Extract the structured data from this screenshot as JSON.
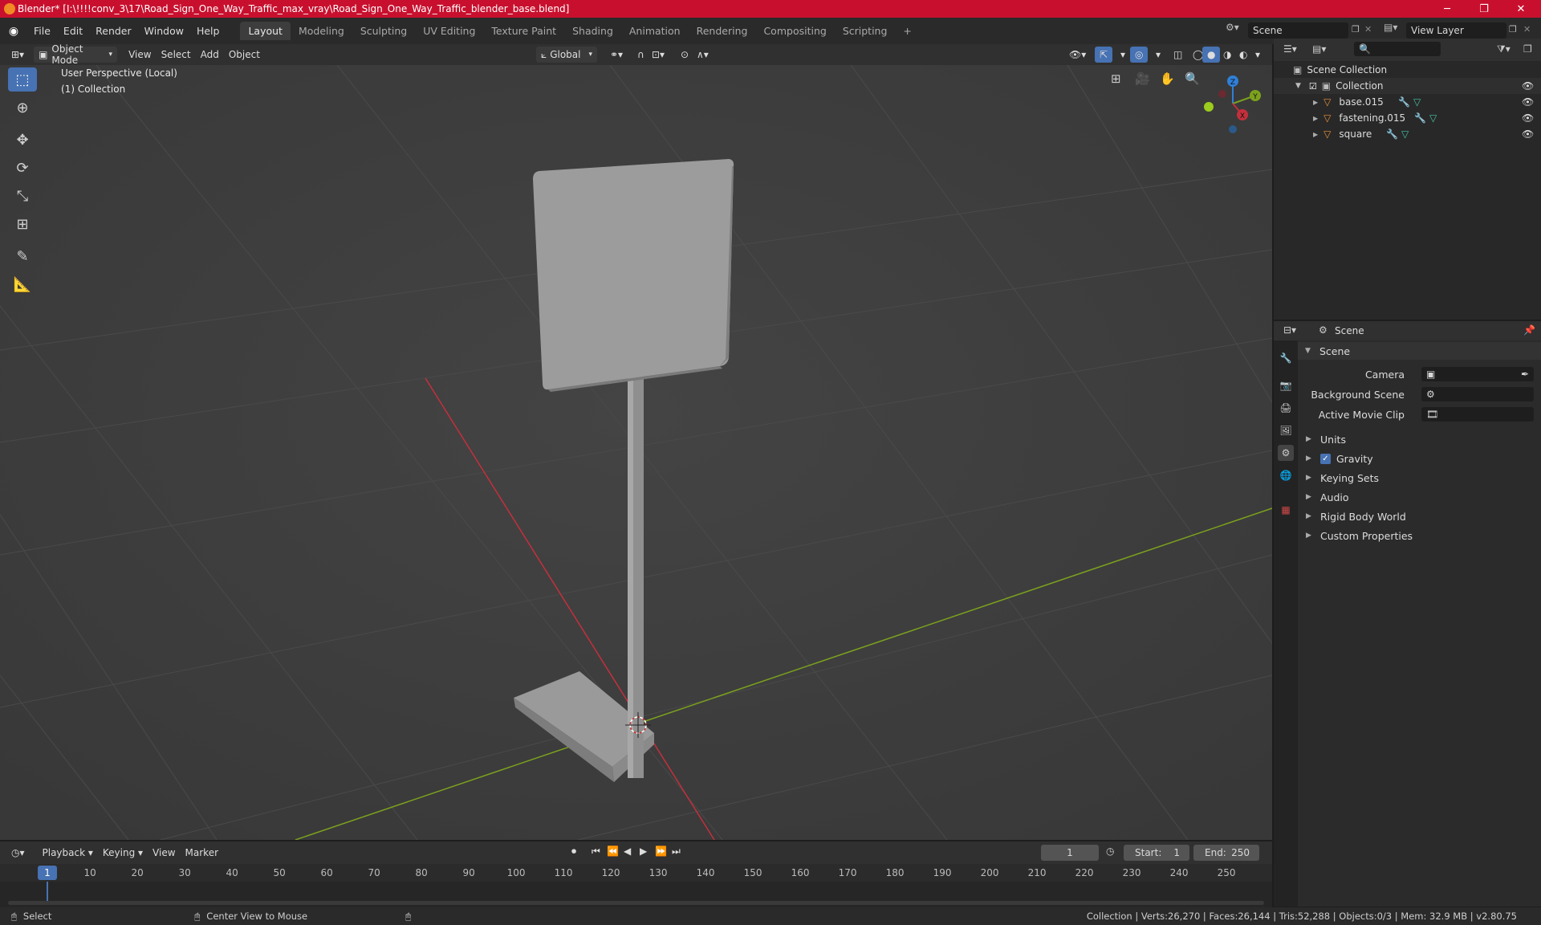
{
  "window": {
    "title": "Blender* [I:\\!!!!conv_3\\17\\Road_Sign_One_Way_Traffic_max_vray\\Road_Sign_One_Way_Traffic_blender_base.blend]",
    "minimize": "─",
    "maximize": "❐",
    "close": "✕"
  },
  "menu": {
    "items": [
      "File",
      "Edit",
      "Render",
      "Window",
      "Help"
    ]
  },
  "workspaces": [
    "Layout",
    "Modeling",
    "Sculpting",
    "UV Editing",
    "Texture Paint",
    "Shading",
    "Animation",
    "Rendering",
    "Compositing",
    "Scripting"
  ],
  "workspace_add": "+",
  "scene_field": "Scene",
  "view_layer_field": "View Layer",
  "viewport_header": {
    "mode": "Object Mode",
    "menus": [
      "View",
      "Select",
      "Add",
      "Object"
    ],
    "orientation": "Global"
  },
  "viewport": {
    "perspective_label": "User Perspective (Local)",
    "collection_label": "(1) Collection",
    "gizmo_axes": {
      "z": "Z",
      "y": "Y",
      "x": "X"
    }
  },
  "outliner": {
    "scene_collection": "Scene Collection",
    "collection": "Collection",
    "objects": [
      {
        "name": "base.015"
      },
      {
        "name": "fastening.015"
      },
      {
        "name": "square"
      }
    ]
  },
  "properties": {
    "header_title": "Scene",
    "panel_title": "Scene",
    "fields": [
      {
        "label": "Camera",
        "value": ""
      },
      {
        "label": "Background Scene",
        "value": ""
      },
      {
        "label": "Active Movie Clip",
        "value": ""
      }
    ],
    "sections": [
      "Units",
      "Gravity",
      "Keying Sets",
      "Audio",
      "Rigid Body World",
      "Custom Properties"
    ],
    "gravity_checked": true
  },
  "timeline": {
    "menus": [
      "Playback",
      "Keying",
      "View",
      "Marker"
    ],
    "current_frame": "1",
    "start_label": "Start:",
    "start_value": "1",
    "end_label": "End:",
    "end_value": "250",
    "ticks": [
      "1",
      "10",
      "20",
      "30",
      "40",
      "50",
      "60",
      "70",
      "80",
      "90",
      "100",
      "110",
      "120",
      "130",
      "140",
      "150",
      "160",
      "170",
      "180",
      "190",
      "200",
      "210",
      "220",
      "230",
      "240",
      "250"
    ]
  },
  "statusbar": {
    "select": "Select",
    "center_view": "Center View to Mouse",
    "stats": "Collection | Verts:26,270 | Faces:26,144 | Tris:52,288 | Objects:0/3 | Mem: 32.9 MB | v2.80.75"
  },
  "colors": {
    "accent": "#4772b3",
    "titlebar": "#c8102e",
    "x_axis": "#c3303c",
    "y_axis": "#7ca21d",
    "z_axis": "#2f80d8"
  }
}
